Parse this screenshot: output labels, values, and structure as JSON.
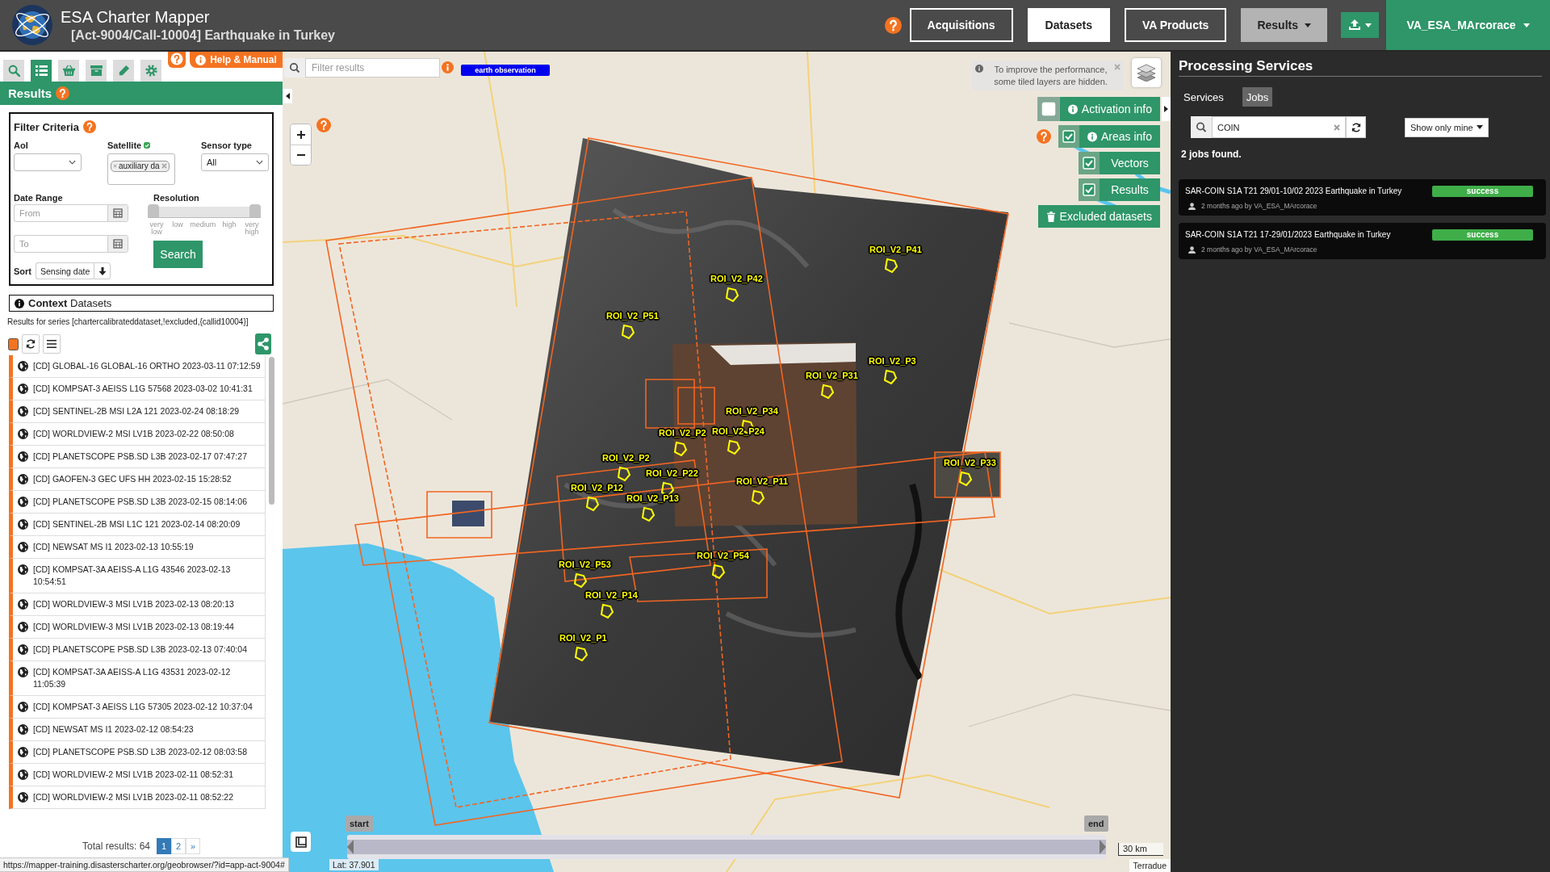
{
  "header": {
    "app_title": "ESA Charter Mapper",
    "subtitle": "[Act-9004/Call-10004] Earthquake in Turkey",
    "nav": [
      {
        "label": "Acquisitions",
        "selected": false
      },
      {
        "label": "Datasets",
        "selected": true
      },
      {
        "label": "VA Products",
        "selected": false
      }
    ],
    "results_menu": "Results",
    "user_menu": "VA_ESA_MArcorace"
  },
  "left_panel": {
    "tools": [
      {
        "kind": "search",
        "selected": false
      },
      {
        "kind": "list",
        "selected": true
      },
      {
        "kind": "basket",
        "selected": false
      },
      {
        "kind": "archive",
        "selected": false
      },
      {
        "kind": "edit",
        "selected": false
      },
      {
        "kind": "settings",
        "selected": false
      }
    ],
    "help_link": "Help & Manual",
    "section_title": "Results",
    "filter": {
      "title": "Filter Criteria",
      "aoi": {
        "label": "AoI"
      },
      "satellite": {
        "label": "Satellite",
        "tags": [
          "auxiliary da"
        ]
      },
      "sensor_type": {
        "label": "Sensor type",
        "value": "All"
      },
      "date_range": {
        "label": "Date Range",
        "from": {
          "placeholder": "From"
        },
        "to": {
          "placeholder": "To"
        }
      },
      "resolution": {
        "label": "Resolution",
        "level": 1,
        "ticks": [
          "very low",
          "low",
          "medium",
          "high",
          "very high"
        ]
      },
      "search_button": "Search",
      "sort": {
        "label": "Sort",
        "value": "Sensing date"
      }
    },
    "context_title": "**Context** Datasets",
    "series_note": "Results for series [chartercalibrateddataset,!excluded,{callid10004}]",
    "datasets": [
      "[CD] GLOBAL-16 GLOBAL-16 ORTHO 2023-03-11 07:12:59",
      "[CD] KOMPSAT-3 AEISS L1G 57568 2023-03-02 10:41:31",
      "[CD] SENTINEL-2B MSI L2A 121 2023-02-24 08:18:29",
      "[CD] WORLDVIEW-2 MSI LV1B 2023-02-22 08:50:08",
      "[CD] PLANETSCOPE PSB.SD L3B 2023-02-17 07:47:27",
      "[CD] GAOFEN-3 GEC UFS HH 2023-02-15 15:28:52",
      "[CD] PLANETSCOPE PSB.SD L3B 2023-02-15 08:14:06",
      "[CD] SENTINEL-2B MSI L1C 121 2023-02-14 08:20:09",
      "[CD] NEWSAT MS I1 2023-02-13 10:55:19",
      "[CD] KOMPSAT-3A AEISS-A L1G 43546 2023-02-13 10:54:51",
      "[CD] WORLDVIEW-3 MSI LV1B 2023-02-13 08:20:13",
      "[CD] WORLDVIEW-3 MSI LV1B 2023-02-13 08:19:44",
      "[CD] PLANETSCOPE PSB.SD L3B 2023-02-13 07:40:04",
      "[CD] KOMPSAT-3A AEISS-A L1G 43531 2023-02-12 11:05:39",
      "[CD] KOMPSAT-3 AEISS L1G 57305 2023-02-12 10:37:04",
      "[CD] NEWSAT MS I1 2023-02-12 08:54:23",
      "[CD] PLANETSCOPE PSB.SD L3B 2023-02-12 08:03:58",
      "[CD] WORLDVIEW-2 MSI LV1B 2023-02-11 08:52:31",
      "[CD] WORLDVIEW-2 MSI LV1B 2023-02-11 08:52:22"
    ],
    "total": "Total results: 64",
    "pages": [
      {
        "label": "1",
        "selected": true
      },
      {
        "label": "2",
        "selected": false
      }
    ],
    "next": "»"
  },
  "map": {
    "filter": {
      "placeholder": "Filter results"
    },
    "tag": "earth observation",
    "notice": "To improve the performance, some tiled layers are hidden.",
    "layers": [
      {
        "label": "Activation info",
        "kind": "info",
        "checked": false
      },
      {
        "label": "Areas info",
        "kind": "info",
        "checked": true
      },
      {
        "label": "Vectors",
        "kind": "plain",
        "checked": true
      },
      {
        "label": "Results",
        "kind": "plain",
        "checked": true
      }
    ],
    "excluded_button": "Excluded datasets",
    "area_labels": [
      "ROI_V2_P41",
      "ROI_V2_P42",
      "ROI_V2_P51",
      "ROI_V2_P3",
      "ROI_V2_P31",
      "ROI_V2_P34",
      "ROI_V2_P2",
      "ROI_V2_P24",
      "ROI_V2_P2",
      "ROI_V2_P22",
      "ROI_V2_P12",
      "ROI_V2_P13",
      "ROI_V2_P11",
      "ROI_V2_P33",
      "ROI_V2_P53",
      "ROI_V2_P54",
      "ROI_V2_P14",
      "ROI_V2_P1"
    ],
    "timeline": {
      "start": "start",
      "end": "end",
      "level": 1
    },
    "scale": "30 km",
    "attribution": "Terradue",
    "latitude": "Lat: 37.901"
  },
  "processing": {
    "title": "Processing Services",
    "tabs": [
      {
        "label": "Services",
        "selected": false
      },
      {
        "label": "Jobs",
        "selected": true
      }
    ],
    "search": {
      "value": "COIN"
    },
    "owner_filter": "Show only mine",
    "count": "2 jobs found.",
    "jobs": [
      {
        "title": "SAR-COIN S1A T21 29/01-10/02 2023 Earthquake in Turkey",
        "meta": "2 months ago by VA_ESA_MArcorace",
        "status": "success"
      },
      {
        "title": "SAR-COIN S1A T21 17-29/01/2023 Earthquake in Turkey",
        "meta": "2 months ago by VA_ESA_MArcorace",
        "status": "success"
      }
    ]
  },
  "status_bar": {
    "url": "https://mapper-training.disasterscharter.org/geobrowser/?id=app-act-9004#"
  }
}
